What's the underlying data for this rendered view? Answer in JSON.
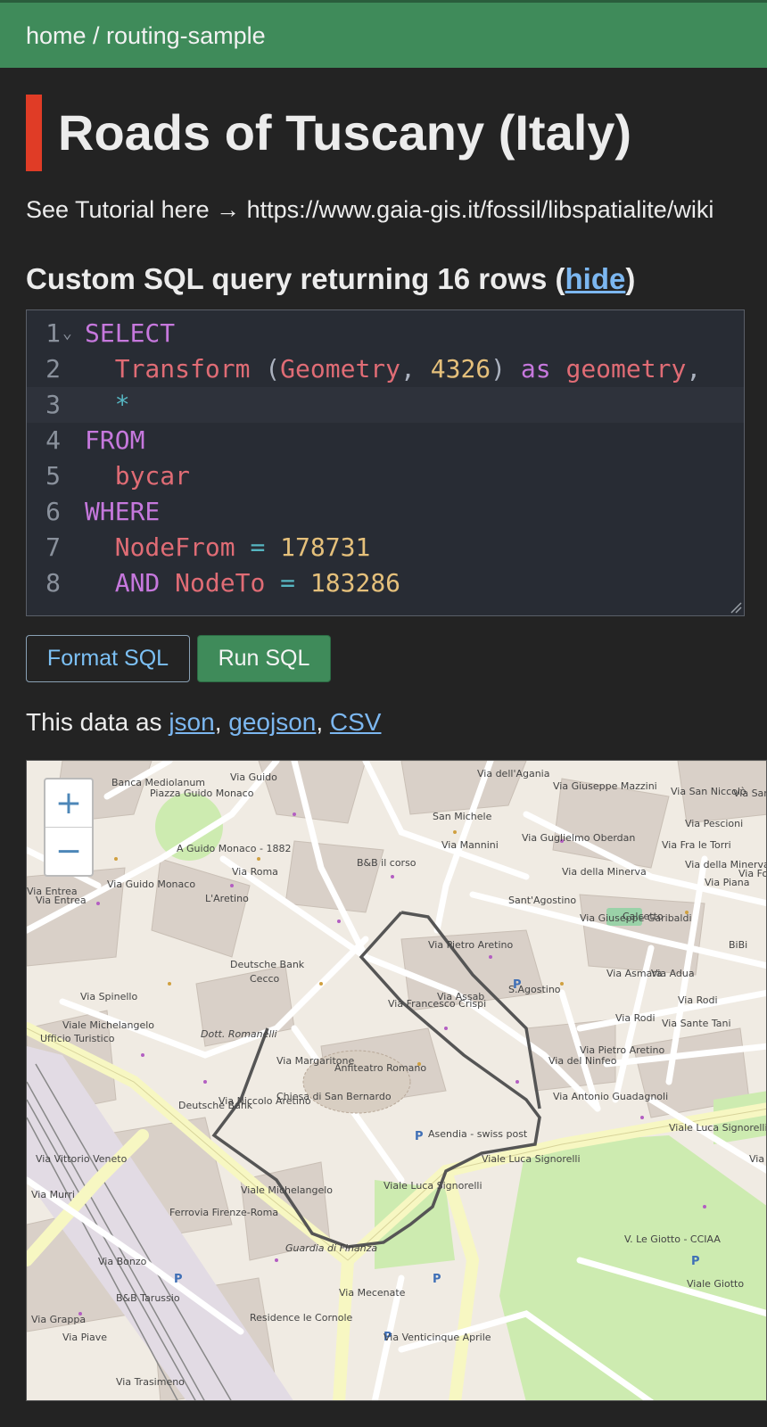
{
  "header": {
    "breadcrumb": "home / routing-sample"
  },
  "page": {
    "title": "Roads of Tuscany (Italy)",
    "tutorial": "See Tutorial here → https://www.gaia-gis.it/fossil/libspatialite/wiki"
  },
  "query": {
    "heading_prefix": "Custom SQL query returning 16 rows (",
    "hide_link": "hide",
    "heading_suffix": ")",
    "lines": [
      {
        "n": "1",
        "tokens": [
          [
            "kw",
            "SELECT"
          ]
        ]
      },
      {
        "n": "2",
        "tokens": [
          [
            "sp",
            "  "
          ],
          [
            "fn",
            "Transform"
          ],
          [
            "sp",
            " "
          ],
          [
            "pu",
            "("
          ],
          [
            "fn",
            "Geometry"
          ],
          [
            "pu",
            ", "
          ],
          [
            "num",
            "4326"
          ],
          [
            "pu",
            ")"
          ],
          [
            "sp",
            " "
          ],
          [
            "kw",
            "as"
          ],
          [
            "sp",
            " "
          ],
          [
            "fn",
            "geometry"
          ],
          [
            "pu",
            ","
          ]
        ]
      },
      {
        "n": "3",
        "tokens": [
          [
            "sp",
            "  "
          ],
          [
            "op",
            "*"
          ]
        ]
      },
      {
        "n": "4",
        "tokens": [
          [
            "kw",
            "FROM"
          ]
        ]
      },
      {
        "n": "5",
        "tokens": [
          [
            "sp",
            "  "
          ],
          [
            "fn",
            "bycar"
          ]
        ]
      },
      {
        "n": "6",
        "tokens": [
          [
            "kw",
            "WHERE"
          ]
        ]
      },
      {
        "n": "7",
        "tokens": [
          [
            "sp",
            "  "
          ],
          [
            "fn",
            "NodeFrom"
          ],
          [
            "sp",
            " "
          ],
          [
            "op",
            "="
          ],
          [
            "sp",
            " "
          ],
          [
            "num",
            "178731"
          ]
        ]
      },
      {
        "n": "8",
        "tokens": [
          [
            "sp",
            "  "
          ],
          [
            "kw",
            "AND"
          ],
          [
            "sp",
            " "
          ],
          [
            "fn",
            "NodeTo"
          ],
          [
            "sp",
            " "
          ],
          [
            "op",
            "="
          ],
          [
            "sp",
            " "
          ],
          [
            "num",
            "183286"
          ]
        ]
      }
    ],
    "fold_icon": "chevron-down-icon"
  },
  "buttons": {
    "format": "Format SQL",
    "run": "Run SQL"
  },
  "export": {
    "prefix": "This data as ",
    "json": "json",
    "sep1": ", ",
    "geojson": "geojson",
    "sep2": ", ",
    "csv": "CSV"
  },
  "map": {
    "zoom_in": "+",
    "zoom_out": "−",
    "labels": [
      "Banca Mediolanum",
      "Piazza Guido Monaco",
      "Via Guido",
      "A Guido Monaco - 1882",
      "San Michele",
      "Via dell'Agania",
      "Via Giuseppe Mazzini",
      "Via San Niccolò",
      "Via San Lorenzo",
      "Via Pescioni",
      "Via Guglielmo Oberdan",
      "Via Mannini",
      "B&B il corso",
      "Via Roma",
      "Via Guido Monaco",
      "L'Aretino",
      "Via della Minerva",
      "Sant'Agostino",
      "Via Giuseppe Garibaldi",
      "Via Fra le Torri",
      "Via della Minerva",
      "Via Piana",
      "Via Fontanella",
      "Calcetto",
      "BiBi",
      "Deutsche Bank",
      "Cecco",
      "Via Pietro Aretino",
      "Via Assab",
      "Via Francesco Crispi",
      "S.Agostino",
      "Via Asmara",
      "Via Adua",
      "Via Rodi",
      "Via Rodi",
      "Via Sante Tani",
      "Via Spinello",
      "Viale Michelangelo",
      "Ufficio Turistico",
      "Dott. Romanelli",
      "Via Margaritone",
      "Chiesa di San Bernardo",
      "Anfiteatro Romano",
      "Via Pietro Aretino",
      "Via del Ninfeo",
      "Via Antonio Guadagnoli",
      "Viale Luca Signorelli",
      "Via Niccolo Aretino",
      "Deutsche Bank",
      "Asendia - swiss post",
      "Viale Luca Signorelli",
      "Viale Luca Signorelli",
      "Viale Michelangelo",
      "Ferrovia Firenze-Roma",
      "Guardia di Finanza",
      "Via Vittorio Veneto",
      "Via Murri",
      "Via Bonzo",
      "B&B Tarussio",
      "Residence le Cornole",
      "Via Mecenate",
      "Via Venticinque Aprile",
      "V. Le Giotto - CCIAA",
      "Viale Giotto",
      "Via Piave",
      "Via Grappa",
      "Via Trasimeno",
      "Via Entrea",
      "Via Entrea",
      "Via Pe"
    ]
  }
}
